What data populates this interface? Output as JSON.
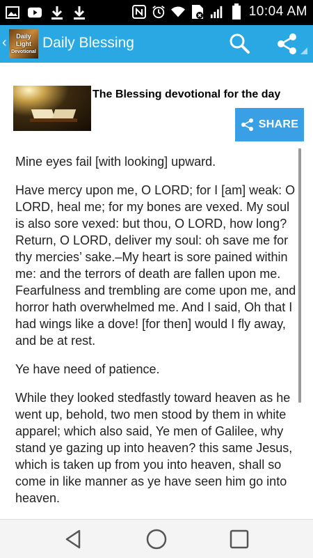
{
  "status_bar": {
    "time": "10:04 AM",
    "left_icons": [
      "picture-icon",
      "youtube-icon",
      "download-icon",
      "download-icon"
    ],
    "right_icons": [
      "nfc-icon",
      "alarm-icon",
      "wifi-icon",
      "sim-icon",
      "signal-icon",
      "battery-icon"
    ]
  },
  "app_bar": {
    "logo_text": [
      "Daily",
      "Light",
      "Devotional"
    ],
    "title": "Daily Blessing",
    "background": "#29a8e3"
  },
  "header": {
    "title": "The Blessing devotional for the day",
    "share_label": "SHARE",
    "share_color": "#3aa0e6"
  },
  "devotional": {
    "paragraphs": [
      "Mine eyes fail [with looking] upward.",
      "Have mercy upon me, O LORD; for I [am] weak: O LORD, heal me; for my bones are vexed. My soul is also sore vexed: but thou, O LORD, how long? Return, O LORD, deliver my soul: oh save me for thy mercies’ sake.–My heart is sore pained within me: and the terrors of death are fallen upon me. Fearfulness and trembling are come upon me, and horror hath overwhelmed me. And I said, Oh that I had wings like a dove! [for then] would I fly away, and be at rest.",
      "Ye have need of patience.",
      "While they looked stedfastly toward heaven as he went up, behold, two men stood by them in white apparel; which also said, Ye men of Galilee, why stand ye gazing up into heaven? this same Jesus, which is taken up from you into heaven, shall so come in like manner as ye have seen him go into heaven."
    ]
  },
  "nav_bar": {
    "buttons": [
      "back-icon",
      "home-icon",
      "recents-icon"
    ]
  }
}
